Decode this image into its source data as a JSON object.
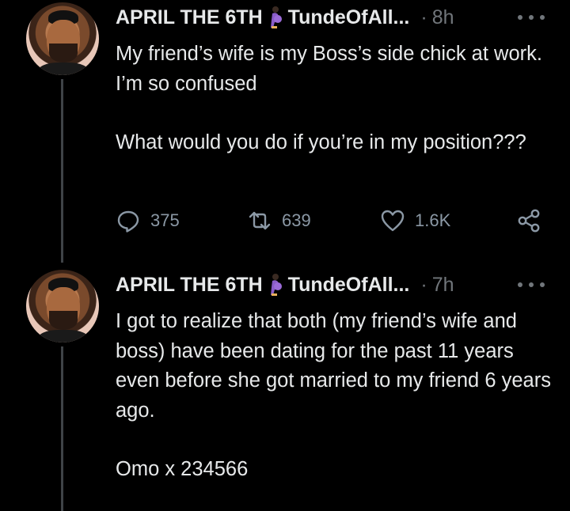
{
  "tweets": [
    {
      "display_name": "APRIL THE 6TH",
      "handle": "TundeOfAll...",
      "separator": "·",
      "time": "8h",
      "paragraphs": [
        "My friend’s wife is my Boss’s side chick at work.  I’m so confused",
        "What would you do if you’re in my position???"
      ],
      "replies": "375",
      "retweets": "639",
      "likes": "1.6K"
    },
    {
      "display_name": "APRIL THE 6TH",
      "handle": "TundeOfAll...",
      "separator": "·",
      "time": "7h",
      "paragraphs": [
        "I got to realize that both (my friend’s wife and boss) have been dating for the past 11 years even before she got married to my friend 6 years ago.",
        "Omo x 234566"
      ]
    }
  ],
  "icons": {
    "badge": "pregnant-person-emoji",
    "more": "more-icon",
    "reply": "reply-icon",
    "retweet": "retweet-icon",
    "like": "heart-icon",
    "share": "share-icon"
  },
  "colors": {
    "background": "#000000",
    "text": "#e7e9ea",
    "secondary": "#71767b",
    "thread_line": "#3f4347"
  }
}
